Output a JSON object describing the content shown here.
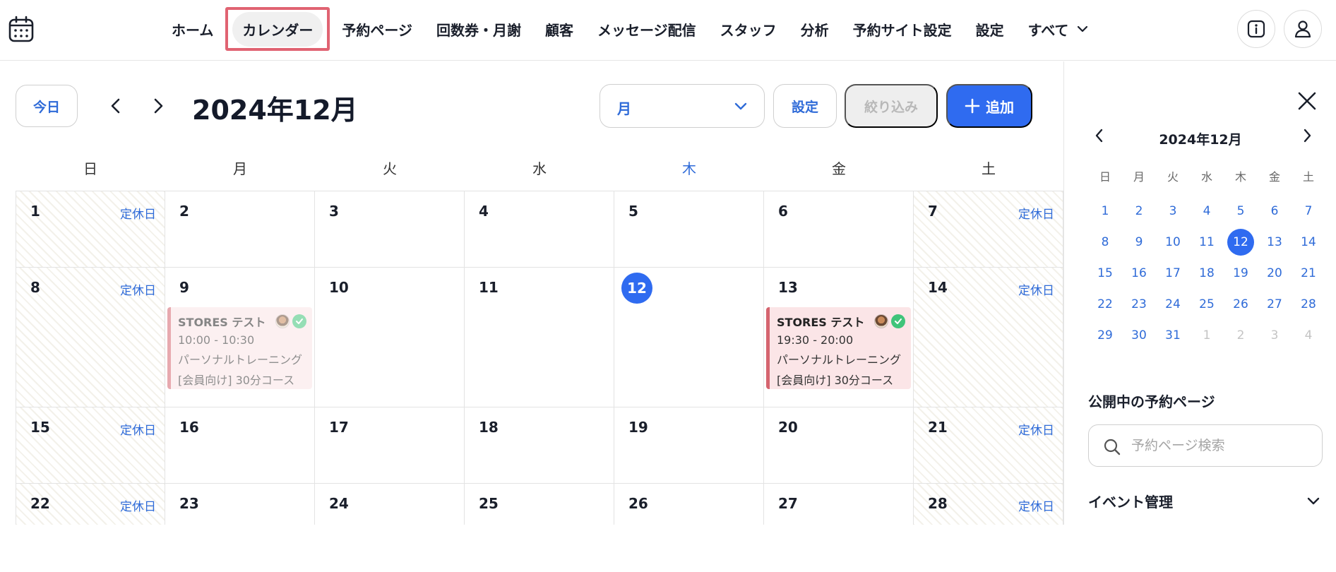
{
  "nav": {
    "items": [
      {
        "label": "ホーム",
        "name": "nav-item-home"
      },
      {
        "label": "カレンダー",
        "name": "nav-item-calendar",
        "active": true
      },
      {
        "label": "予約ページ",
        "name": "nav-item-reservation-page"
      },
      {
        "label": "回数券・月謝",
        "name": "nav-item-tickets"
      },
      {
        "label": "顧客",
        "name": "nav-item-customers"
      },
      {
        "label": "メッセージ配信",
        "name": "nav-item-messages"
      },
      {
        "label": "スタッフ",
        "name": "nav-item-staff"
      },
      {
        "label": "分析",
        "name": "nav-item-analytics"
      },
      {
        "label": "予約サイト設定",
        "name": "nav-item-site-settings"
      },
      {
        "label": "設定",
        "name": "nav-item-settings"
      },
      {
        "label": "すべて",
        "name": "nav-item-all",
        "dropdown": true
      }
    ]
  },
  "toolbar": {
    "today_label": "今日",
    "month_title": "2024年12月",
    "view_value": "月",
    "settings_label": "設定",
    "filter_label": "絞り込み",
    "add_label": "追加"
  },
  "weekdays": [
    "日",
    "月",
    "火",
    "水",
    "木",
    "金",
    "土"
  ],
  "today_weekday_index": 4,
  "holiday_label": "定休日",
  "weeks": [
    [
      {
        "day": "1",
        "holiday": true
      },
      {
        "day": "2"
      },
      {
        "day": "3"
      },
      {
        "day": "4"
      },
      {
        "day": "5"
      },
      {
        "day": "6"
      },
      {
        "day": "7",
        "holiday": true
      }
    ],
    [
      {
        "day": "8",
        "holiday": true
      },
      {
        "day": "9",
        "event": {
          "title": "STORES テスト",
          "time": "10:00 - 10:30",
          "desc1": "パーソナルトレーニング",
          "desc2": "[会員向け] 30分コース",
          "past": true
        }
      },
      {
        "day": "10"
      },
      {
        "day": "11"
      },
      {
        "day": "12",
        "today": true
      },
      {
        "day": "13",
        "event": {
          "title": "STORES テスト",
          "time": "19:30 - 20:00",
          "desc1": "パーソナルトレーニング",
          "desc2": "[会員向け] 30分コース",
          "past": false
        }
      },
      {
        "day": "14",
        "holiday": true
      }
    ],
    [
      {
        "day": "15",
        "holiday": true
      },
      {
        "day": "16"
      },
      {
        "day": "17"
      },
      {
        "day": "18"
      },
      {
        "day": "19"
      },
      {
        "day": "20"
      },
      {
        "day": "21",
        "holiday": true
      }
    ],
    [
      {
        "day": "22",
        "holiday": true
      },
      {
        "day": "23"
      },
      {
        "day": "24"
      },
      {
        "day": "25"
      },
      {
        "day": "26"
      },
      {
        "day": "27"
      },
      {
        "day": "28",
        "holiday": true
      }
    ]
  ],
  "side": {
    "mini_title": "2024年12月",
    "mini_weekdays": [
      "日",
      "月",
      "火",
      "水",
      "木",
      "金",
      "土"
    ],
    "mini_weeks": [
      [
        {
          "d": "1"
        },
        {
          "d": "2"
        },
        {
          "d": "3"
        },
        {
          "d": "4"
        },
        {
          "d": "5"
        },
        {
          "d": "6"
        },
        {
          "d": "7"
        }
      ],
      [
        {
          "d": "8"
        },
        {
          "d": "9"
        },
        {
          "d": "10"
        },
        {
          "d": "11"
        },
        {
          "d": "12",
          "sel": true
        },
        {
          "d": "13"
        },
        {
          "d": "14"
        }
      ],
      [
        {
          "d": "15"
        },
        {
          "d": "16"
        },
        {
          "d": "17"
        },
        {
          "d": "18"
        },
        {
          "d": "19"
        },
        {
          "d": "20"
        },
        {
          "d": "21"
        }
      ],
      [
        {
          "d": "22"
        },
        {
          "d": "23"
        },
        {
          "d": "24"
        },
        {
          "d": "25"
        },
        {
          "d": "26"
        },
        {
          "d": "27"
        },
        {
          "d": "28"
        }
      ],
      [
        {
          "d": "29"
        },
        {
          "d": "30"
        },
        {
          "d": "31"
        },
        {
          "d": "1",
          "other": true
        },
        {
          "d": "2",
          "other": true
        },
        {
          "d": "3",
          "other": true
        },
        {
          "d": "4",
          "other": true
        }
      ]
    ],
    "published_title": "公開中の予約ページ",
    "search_placeholder": "予約ページ検索",
    "event_mgmt_label": "イベント管理"
  },
  "colors": {
    "accent": "#2f6bf0",
    "link": "#2f6bd8",
    "highlight_border": "#e06372",
    "event_bg": "#fbe5e7",
    "event_bar": "#d5646f"
  }
}
